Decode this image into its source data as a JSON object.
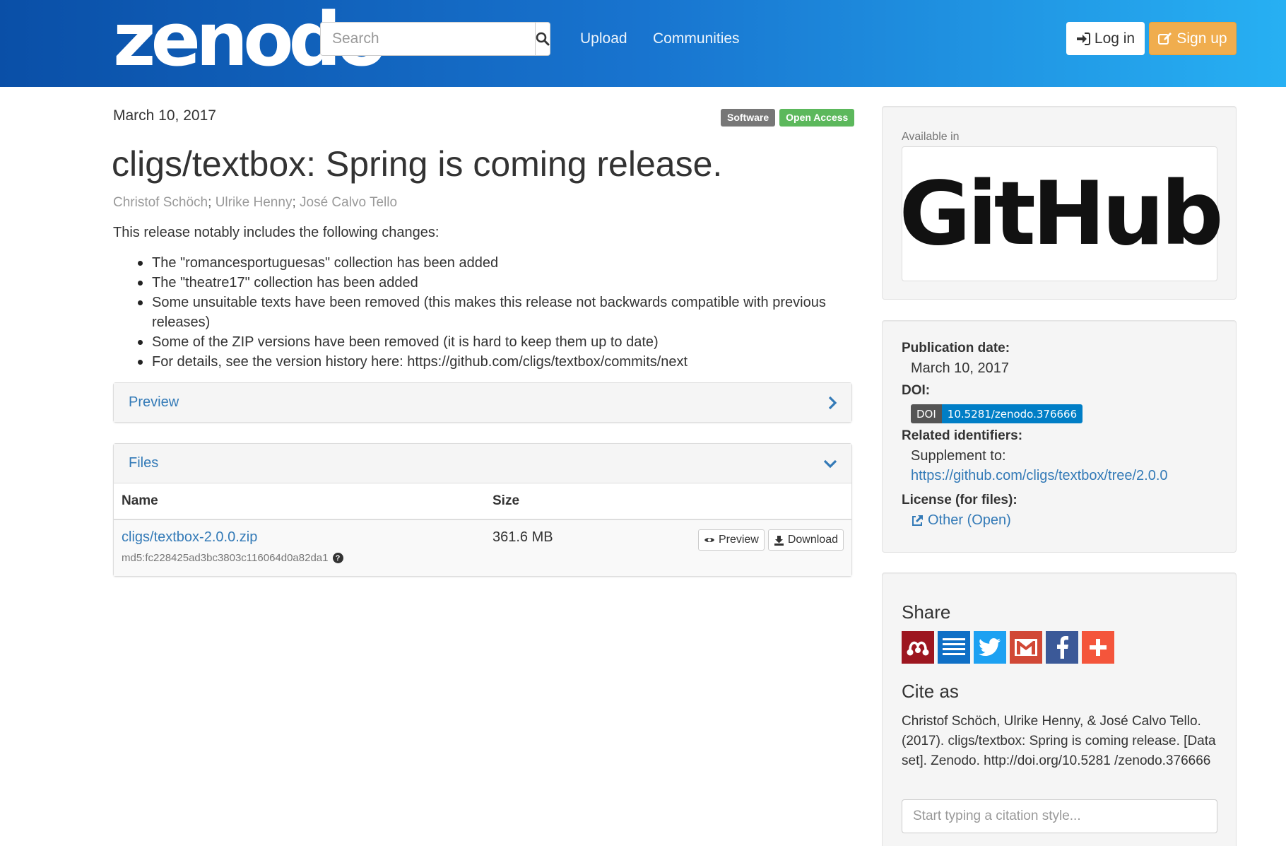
{
  "header": {
    "logo_text": "zenodo",
    "search": {
      "placeholder": "Search",
      "value": ""
    },
    "nav": {
      "upload": "Upload",
      "communities": "Communities"
    },
    "login_label": "Log in",
    "signup_label": "Sign up",
    "colors": {
      "gradient_start": "#0a4fa7",
      "gradient_end": "#27b0f3",
      "signup": "#f0ad4e"
    }
  },
  "record": {
    "date": "March 10, 2017",
    "badges": {
      "type": "Software",
      "access": "Open Access"
    },
    "title": "cligs/textbox: Spring is coming release.",
    "authors": [
      "Christof Schöch",
      "Ulrike Henny",
      "José Calvo Tello"
    ],
    "intro": "This release notably includes the following changes:",
    "changes": [
      "The \"romancesportuguesas\" collection has been added",
      "The \"theatre17\" collection has been added",
      "Some unsuitable texts have been removed (this makes this release not backwards compatible with previous releases)",
      "Some of the ZIP versions have been removed (it is hard to keep them up to date)",
      "For details, see the version history here: https://github.com/cligs/textbox/commits/next"
    ]
  },
  "preview_panel": {
    "label": "Preview",
    "icon": "chevron-right-icon"
  },
  "files_panel": {
    "label": "Files",
    "icon": "chevron-down-icon",
    "columns": {
      "name": "Name",
      "size": "Size"
    },
    "rows": [
      {
        "name": "cligs/textbox-2.0.0.zip",
        "md5": "md5:fc228425ad3bc3803c116064d0a82da1",
        "size": "361.6 MB",
        "preview_label": "Preview",
        "download_label": "Download"
      }
    ]
  },
  "sidebar": {
    "available_in": "Available in",
    "platform": "GitHub",
    "meta": {
      "pub_date_label": "Publication date:",
      "pub_date": "March 10, 2017",
      "doi_label": "DOI:",
      "doi_badge_left": "DOI",
      "doi_badge_right": "10.5281/zenodo.376666",
      "related_label": "Related identifiers:",
      "supplement_label": "Supplement to:",
      "supplement_link": "https://github.com/cligs/textbox/tree/2.0.0",
      "license_label": "License (for files):",
      "license_value": "Other (Open)"
    },
    "share": {
      "heading": "Share",
      "buttons": [
        {
          "name": "mendeley-icon",
          "color": "#9d1620"
        },
        {
          "name": "citeulike-icon",
          "color": "#0f6fc6"
        },
        {
          "name": "twitter-icon",
          "color": "#1da1f2"
        },
        {
          "name": "gmail-icon",
          "color": "#d14836"
        },
        {
          "name": "facebook-icon",
          "color": "#3b5998"
        },
        {
          "name": "plus-icon",
          "color": "#f4553b"
        }
      ]
    },
    "cite": {
      "heading": "Cite as",
      "text": "Christof Schöch, Ulrike Henny, & José Calvo Tello. (2017). cligs/textbox: Spring is coming release. [Data set]. Zenodo. http://doi.org/10.5281 /zenodo.376666",
      "placeholder": "Start typing a citation style..."
    }
  }
}
